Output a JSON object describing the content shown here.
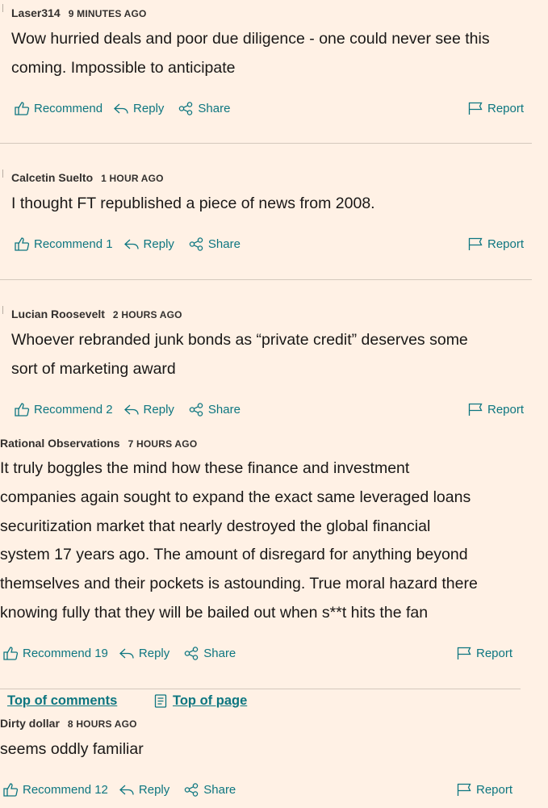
{
  "actions": {
    "reply": "Reply",
    "share": "Share",
    "report": "Report"
  },
  "comments": [
    {
      "author": "Laser314",
      "time": "9 MINUTES AGO",
      "lines": [
        "Wow hurried deals and poor due diligence - one could never see this",
        "coming. Impossible to anticipate"
      ],
      "recommend": "Recommend"
    },
    {
      "author": "Calcetin Suelto",
      "time": "1 HOUR AGO",
      "lines": [
        "I thought FT republished a piece of news from 2008."
      ],
      "recommend": "Recommend 1"
    },
    {
      "author": "Lucian Roosevelt",
      "time": "2 HOURS AGO",
      "lines": [
        "Whoever rebranded junk bonds as “private credit” deserves some",
        "sort of marketing award"
      ],
      "recommend": "Recommend 2"
    },
    {
      "author": "Rational Observations",
      "time": "7 HOURS AGO",
      "lines": [
        "It truly boggles the mind how these finance and investment",
        "companies again sought to expand the exact same leveraged loans",
        "securitization market that nearly destroyed the global financial",
        "system 17 years ago. The amount of disregard for anything beyond",
        "themselves and their pockets is astounding. True moral hazard there",
        "knowing fully that they will be bailed out when s**t hits the fan"
      ],
      "recommend": "Recommend 19"
    },
    {
      "author": "Dirty dollar",
      "time": "8 HOURS AGO",
      "lines": [
        "seems oddly familiar"
      ],
      "recommend": "Recommend 12"
    }
  ],
  "nav": {
    "top_of_comments": "Top of comments",
    "top_of_page": "Top of page"
  }
}
